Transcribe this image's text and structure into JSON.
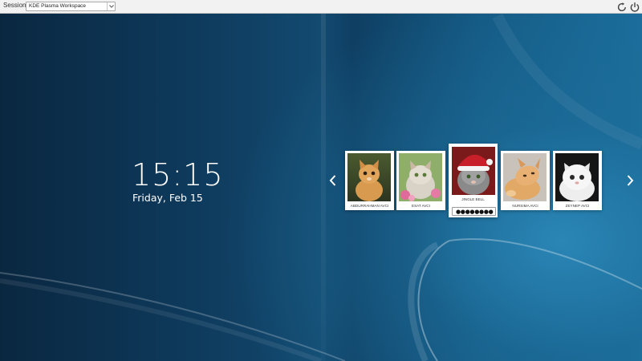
{
  "topbar": {
    "sessions_label": "Sessions:",
    "session_value": "KDE Plasma Workspace"
  },
  "clock": {
    "time": "15:15",
    "date": "Friday, Feb 15"
  },
  "users": [
    {
      "name": "ABDURRAHMAN AVCI",
      "photo": "cat-tabby-kitten"
    },
    {
      "name": "ESAT AVCI",
      "photo": "cat-kitten-flowers"
    },
    {
      "name": "JINGLE BELL",
      "photo": "cat-santa-hat",
      "selected": true
    },
    {
      "name": "NURSIMA AVCI",
      "photo": "cat-playful-kitten"
    },
    {
      "name": "ZEYNEP AVCI",
      "photo": "cat-white-persian"
    }
  ],
  "login": {
    "password_mask": "●●●●●●●●"
  },
  "icons": {
    "restart": "restart-icon",
    "shutdown": "power-icon",
    "prev": "chevron-left-icon",
    "next": "chevron-right-icon"
  },
  "colors": {
    "background_dark": "#0a2740",
    "background_light": "#2a86b6",
    "topbar": "#f2f2f2"
  }
}
